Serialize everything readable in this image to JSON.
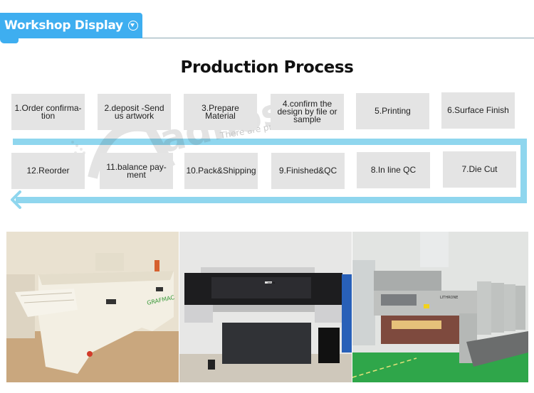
{
  "header": {
    "title": "Workshop Display",
    "icon": "circle-arrow-down-icon",
    "accent_color": "#3eaef0"
  },
  "section": {
    "title": "Production Process"
  },
  "process": {
    "track_color": "#8fd6ee",
    "top_row": [
      {
        "label": "1.Order confirma- tion"
      },
      {
        "label": "2.deposit -Send us artwork"
      },
      {
        "label": "3.Prepare Material"
      },
      {
        "label": "4.confirm the design by file or sample"
      },
      {
        "label": "5.Printing"
      },
      {
        "label": "6.Surface Finish"
      }
    ],
    "bottom_row": [
      {
        "label": "12.Reorder"
      },
      {
        "label": "11.balance pay- ment"
      },
      {
        "label": "10.Pack&Shipping"
      },
      {
        "label": "9.Finished&QC"
      },
      {
        "label": "8.In line QC"
      },
      {
        "label": "7.Die Cut"
      }
    ]
  },
  "watermark": {
    "brand": "adnose.com",
    "tagline": "There are preferen"
  },
  "photos": [
    {
      "name": "plate-processor-machine",
      "label_on_machine": "GRAFMAC"
    },
    {
      "name": "wide-format-printer",
      "label_on_machine": "EPSON"
    },
    {
      "name": "offset-printing-press",
      "label_on_machine": "LITHRONE"
    }
  ]
}
